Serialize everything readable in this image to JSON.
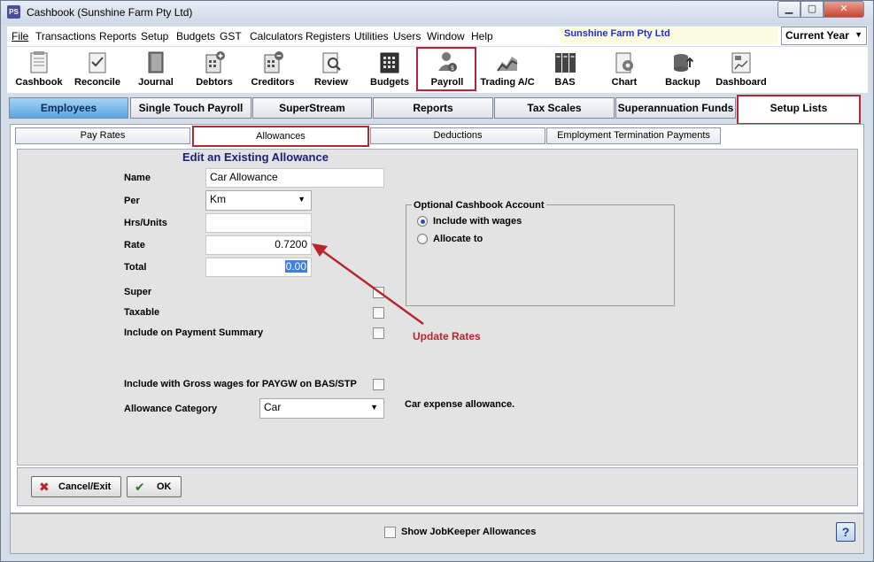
{
  "window": {
    "title": "Cashbook (Sunshine Farm Pty Ltd)",
    "app_icon": "PS"
  },
  "menu": [
    "File",
    "Transactions",
    "Reports",
    "Setup",
    "Budgets",
    "GST",
    "Calculators",
    "Registers",
    "Utilities",
    "Users",
    "Window",
    "Help"
  ],
  "company": "Sunshine Farm Pty Ltd",
  "period": "Current Year",
  "toolbar": [
    {
      "label": "Cashbook",
      "icon": "cashbook-icon"
    },
    {
      "label": "Reconcile",
      "icon": "reconcile-icon"
    },
    {
      "label": "Journal",
      "icon": "journal-icon"
    },
    {
      "label": "Debtors",
      "icon": "debtors-icon"
    },
    {
      "label": "Creditors",
      "icon": "creditors-icon"
    },
    {
      "label": "Review",
      "icon": "review-icon"
    },
    {
      "label": "Budgets",
      "icon": "budgets-icon"
    },
    {
      "label": "Payroll",
      "icon": "payroll-icon"
    },
    {
      "label": "Trading A/C",
      "icon": "trading-icon"
    },
    {
      "label": "BAS",
      "icon": "bas-icon"
    },
    {
      "label": "Chart",
      "icon": "chart-icon"
    },
    {
      "label": "Backup",
      "icon": "backup-icon"
    },
    {
      "label": "Dashboard",
      "icon": "dashboard-icon"
    }
  ],
  "main_tabs": [
    "Employees",
    "Single Touch Payroll",
    "SuperStream",
    "Reports",
    "Tax Scales",
    "Superannuation Funds",
    "Setup Lists"
  ],
  "sub_tabs": [
    "Pay Rates",
    "Allowances",
    "Deductions",
    "Employment Termination Payments"
  ],
  "form": {
    "title": "Edit an Existing Allowance",
    "name_label": "Name",
    "name_value": "Car Allowance",
    "per_label": "Per",
    "per_value": "Km",
    "hrs_label": "Hrs/Units",
    "hrs_value": "",
    "rate_label": "Rate",
    "rate_value": "0.7200",
    "total_label": "Total",
    "total_value": "0.00",
    "super_label": "Super",
    "taxable_label": "Taxable",
    "payment_summary_label": "Include on Payment Summary",
    "gross_wages_label": "Include with Gross wages for PAYGW on BAS/STP",
    "category_label": "Allowance Category",
    "category_value": "Car",
    "category_desc": "Car expense allowance."
  },
  "cashbook_account": {
    "title": "Optional Cashbook Account",
    "option_wages": "Include with wages",
    "option_allocate": "Allocate to"
  },
  "annotation": "Update Rates",
  "buttons": {
    "cancel": "Cancel/Exit",
    "ok": "OK"
  },
  "jobkeeper_label": "Show JobKeeper Allowances",
  "help": "?"
}
